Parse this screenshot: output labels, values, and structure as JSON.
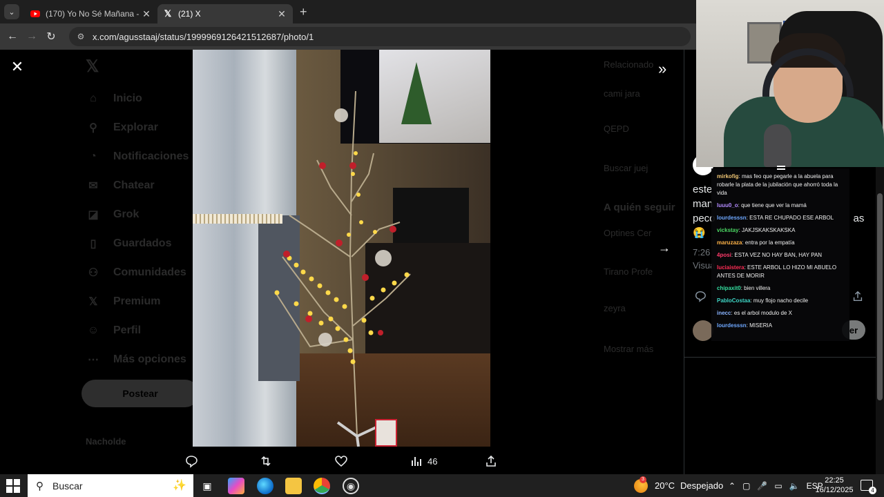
{
  "browser": {
    "tabs": [
      {
        "label": "(170) Yo No Sé Mañana - YouTube",
        "active": false,
        "icon": "youtube-icon"
      },
      {
        "label": "(21) X",
        "active": true,
        "icon": "x-logo-icon"
      }
    ],
    "url": "x.com/agusstaaj/status/1999969126421512687/photo/1"
  },
  "x_nav": {
    "items": [
      "Inicio",
      "Explorar",
      "Notificaciones",
      "Chatear",
      "Grok",
      "Guardados",
      "Comunidades",
      "Premium",
      "Perfil",
      "Más opciones"
    ],
    "post_label": "Postear",
    "profile_name": "Nacholde"
  },
  "right_rail": {
    "lines": [
      "Relacionado",
      "cami jara",
      "QEPD",
      "Buscar juej",
      "A quién seguir",
      "Optines Cer",
      "Tirano Profe",
      "zeyra",
      "Mostrar más"
    ]
  },
  "photo_actions": {
    "views_count": "46"
  },
  "tweet_panel": {
    "text_lines": [
      "este",
      "man",
      "peco"
    ],
    "text_suffix": "as",
    "emoji": "😭",
    "time": "7:26",
    "views_label": "Visua",
    "reply_btn": "er"
  },
  "chat": [
    {
      "user": "mirkofig",
      "color": "#f0c674",
      "text": "mas feo que pegarle a la abuela para robarle la plata de la jubilación que ahorró toda la vida"
    },
    {
      "user": "luuu0_o",
      "color": "#b48cff",
      "text": "que tiene que ver la mamá"
    },
    {
      "user": "lourdesssn",
      "color": "#6fa8ff",
      "text": "ESTA RE CHUPADO ESE ARBOL"
    },
    {
      "user": "vickstay",
      "color": "#4cd964",
      "text": "JAKJSKAKSKAKSKA"
    },
    {
      "user": "maruzaza",
      "color": "#ffb347",
      "text": "entra por la empatía"
    },
    {
      "user": "4posi",
      "color": "#ff3b6b",
      "text": "ESTA VEZ NO HAY BAN, HAY PAN"
    },
    {
      "user": "luciaistera",
      "color": "#ff2d55",
      "text": "ESTE ARBOL LO HIZO MI ABUELO ANTES DE MORIR"
    },
    {
      "user": "chipaxit0",
      "color": "#34e0a1",
      "text": "bien villera"
    },
    {
      "user": "PabloCostaa",
      "color": "#3fd6c6",
      "text": "muy flojo nacho decile"
    },
    {
      "user": "inecc",
      "color": "#8ab4ff",
      "text": "es el arbol modulo de X"
    },
    {
      "user": "lourdesssn",
      "color": "#6fa8ff",
      "text": "MISERIA"
    }
  ],
  "taskbar": {
    "search_placeholder": "Buscar",
    "weather_temp": "20°C",
    "weather_desc": "Despejado",
    "weather_badge": "3",
    "language": "ESP",
    "time": "22:25",
    "date": "16/12/2025",
    "notifications": "4"
  }
}
